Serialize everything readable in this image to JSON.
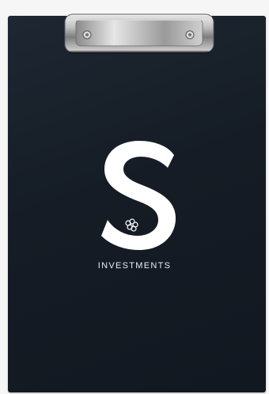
{
  "logo": {
    "icon": "s-investments-logo-icon",
    "letter": "S",
    "wordmark": "INVESTMENTS"
  },
  "colors": {
    "board": "#151c25",
    "logo": "#ffffff",
    "clip_metal": "#c9c9c9"
  }
}
